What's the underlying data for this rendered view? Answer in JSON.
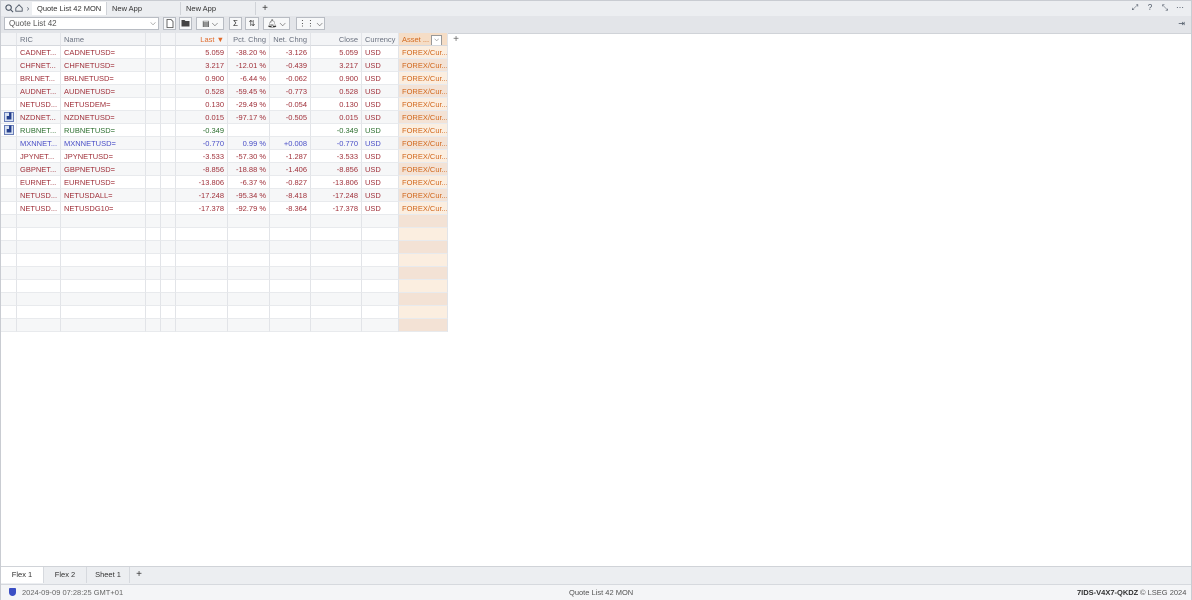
{
  "topbar": {
    "tabs": [
      "Quote List 42 MON",
      "New App",
      "New App"
    ],
    "add_tab": "+"
  },
  "toolbar": {
    "list_name": "Quote List 42"
  },
  "grid": {
    "headers": {
      "ric": "RIC",
      "name": "Name",
      "last": "Last",
      "last_sort": "▼",
      "pct_chng": "Pct. Chng",
      "net_chng": "Net. Chng",
      "close": "Close",
      "currency": "Currency",
      "asset": "Asset ...",
      "add_col": "+"
    },
    "rows": [
      {
        "ric": "CADNET...",
        "name": "CADNETUSD=",
        "last": "5.059",
        "pct": "-38.20 %",
        "net": "-3.126",
        "close": "5.059",
        "ccy": "USD",
        "asset": "FOREX/Cur...",
        "color": "red",
        "chart": false
      },
      {
        "ric": "CHFNET...",
        "name": "CHFNETUSD=",
        "last": "3.217",
        "pct": "-12.01 %",
        "net": "-0.439",
        "close": "3.217",
        "ccy": "USD",
        "asset": "FOREX/Cur...",
        "color": "red",
        "chart": false
      },
      {
        "ric": "BRLNET...",
        "name": "BRLNETUSD=",
        "last": "0.900",
        "pct": "-6.44 %",
        "net": "-0.062",
        "close": "0.900",
        "ccy": "USD",
        "asset": "FOREX/Cur...",
        "color": "red",
        "chart": false
      },
      {
        "ric": "AUDNET...",
        "name": "AUDNETUSD=",
        "last": "0.528",
        "pct": "-59.45 %",
        "net": "-0.773",
        "close": "0.528",
        "ccy": "USD",
        "asset": "FOREX/Cur...",
        "color": "red",
        "chart": false
      },
      {
        "ric": "NETUSD...",
        "name": "NETUSDEM=",
        "last": "0.130",
        "pct": "-29.49 %",
        "net": "-0.054",
        "close": "0.130",
        "ccy": "USD",
        "asset": "FOREX/Cur...",
        "color": "red",
        "chart": false
      },
      {
        "ric": "NZDNET...",
        "name": "NZDNETUSD=",
        "last": "0.015",
        "pct": "-97.17 %",
        "net": "-0.505",
        "close": "0.015",
        "ccy": "USD",
        "asset": "FOREX/Cur...",
        "color": "red",
        "chart": true
      },
      {
        "ric": "RUBNET...",
        "name": "RUBNETUSD=",
        "last": "-0.349",
        "pct": "",
        "net": "",
        "close": "-0.349",
        "ccy": "USD",
        "asset": "FOREX/Cur...",
        "color": "green",
        "chart": true
      },
      {
        "ric": "MXNNET...",
        "name": "MXNNETUSD=",
        "last": "-0.770",
        "pct": "0.99 %",
        "net": "+0.008",
        "close": "-0.770",
        "ccy": "USD",
        "asset": "FOREX/Cur...",
        "color": "blue",
        "chart": false
      },
      {
        "ric": "JPYNET...",
        "name": "JPYNETUSD=",
        "last": "-3.533",
        "pct": "-57.30 %",
        "net": "-1.287",
        "close": "-3.533",
        "ccy": "USD",
        "asset": "FOREX/Cur...",
        "color": "red",
        "chart": false
      },
      {
        "ric": "GBPNET...",
        "name": "GBPNETUSD=",
        "last": "-8.856",
        "pct": "-18.88 %",
        "net": "-1.406",
        "close": "-8.856",
        "ccy": "USD",
        "asset": "FOREX/Cur...",
        "color": "red",
        "chart": false
      },
      {
        "ric": "EURNET...",
        "name": "EURNETUSD=",
        "last": "-13.806",
        "pct": "-6.37 %",
        "net": "-0.827",
        "close": "-13.806",
        "ccy": "USD",
        "asset": "FOREX/Cur...",
        "color": "red",
        "chart": false
      },
      {
        "ric": "NETUSD...",
        "name": "NETUSDALL=",
        "last": "-17.248",
        "pct": "-95.34 %",
        "net": "-8.418",
        "close": "-17.248",
        "ccy": "USD",
        "asset": "FOREX/Cur...",
        "color": "red",
        "chart": false
      },
      {
        "ric": "NETUSD...",
        "name": "NETUSDG10=",
        "last": "-17.378",
        "pct": "-92.79 %",
        "net": "-8.364",
        "close": "-17.378",
        "ccy": "USD",
        "asset": "FOREX/Cur...",
        "color": "red",
        "chart": false
      }
    ],
    "empty_rows": 9
  },
  "sheets": {
    "tabs": [
      "Flex 1",
      "Flex 2",
      "Sheet 1"
    ],
    "add": "+"
  },
  "status": {
    "timestamp": "2024-09-09 07:28:25 GMT+01",
    "center": "Quote List 42 MON",
    "session_id": "7IDS-V4X7-QKDZ",
    "copyright": "© LSEG 2024"
  },
  "colors": {
    "down": "#a0303a",
    "up_green": "#2e7031",
    "up_blue": "#4a4fc7",
    "asset_column": "#fbeee0",
    "sort_header": "#e0692a"
  }
}
